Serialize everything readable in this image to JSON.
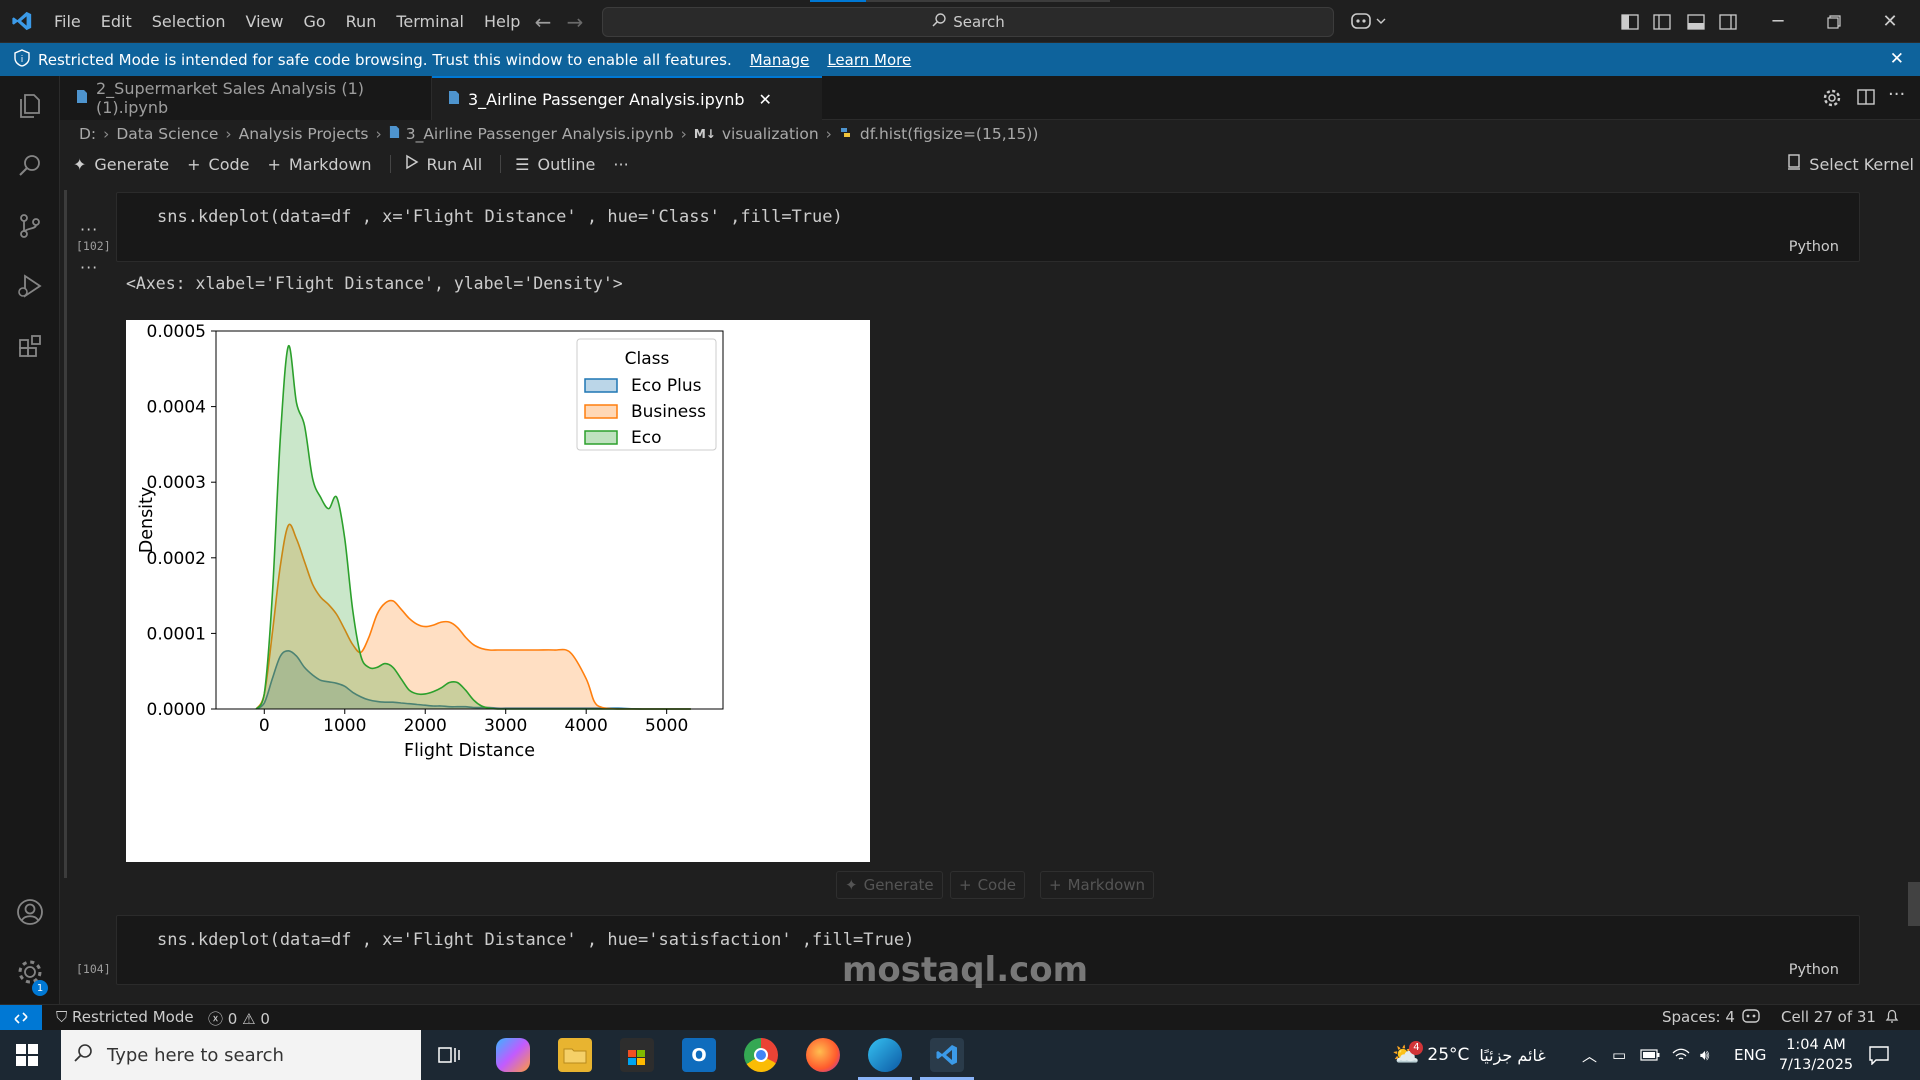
{
  "titlebar": {
    "menu": [
      "File",
      "Edit",
      "Selection",
      "View",
      "Go",
      "Run",
      "Terminal",
      "Help"
    ],
    "search_label": "Search"
  },
  "banner": {
    "message": "Restricted Mode is intended for safe code browsing. Trust this window to enable all features.",
    "manage": "Manage",
    "learn_more": "Learn More"
  },
  "tabs": [
    {
      "label": "2_Supermarket Sales Analysis (1) (1).ipynb",
      "active": false
    },
    {
      "label": "3_Airline Passenger Analysis.ipynb",
      "active": true
    }
  ],
  "breadcrumb": [
    "D:",
    "Data Science",
    "Analysis Projects",
    "3_Airline Passenger Analysis.ipynb",
    "visualization",
    "df.hist(figsize=(15,15))"
  ],
  "breadcrumb_md_tag": "M↓",
  "toolbar": {
    "generate": "Generate",
    "code": "Code",
    "markdown": "Markdown",
    "run_all": "Run All",
    "outline": "Outline",
    "more": "···",
    "select_kernel": "Select Kernel"
  },
  "cells": [
    {
      "exec": "[102]",
      "code": "sns.kdeplot(data=df , x='Flight Distance' , hue='Class' ,fill=True)",
      "lang": "Python",
      "output_text": "<Axes: xlabel='Flight Distance', ylabel='Density'>"
    },
    {
      "exec": "[104]",
      "code": "sns.kdeplot(data=df , x='Flight Distance' , hue='satisfaction' ,fill=True)",
      "lang": "Python"
    }
  ],
  "ghost_buttons": {
    "generate": "Generate",
    "code": "Code",
    "markdown": "Markdown"
  },
  "output_dots": "···",
  "chart_data": {
    "type": "area",
    "xlabel": "Flight Distance",
    "ylabel": "Density",
    "xlim": [
      -600,
      5700
    ],
    "ylim": [
      0,
      0.0005
    ],
    "xticks": [
      0,
      1000,
      2000,
      3000,
      4000,
      5000
    ],
    "yticks": [
      "0.0000",
      "0.0001",
      "0.0002",
      "0.0003",
      "0.0004",
      "0.0005"
    ],
    "legend": {
      "title": "Class",
      "placement": "top-right"
    },
    "x": [
      -100,
      0,
      100,
      200,
      300,
      400,
      500,
      600,
      700,
      800,
      900,
      1000,
      1100,
      1200,
      1300,
      1400,
      1500,
      1600,
      1700,
      1800,
      1900,
      2000,
      2100,
      2200,
      2300,
      2400,
      2500,
      2600,
      2700,
      2800,
      2900,
      3000,
      3200,
      3400,
      3600,
      3800,
      4000,
      4100,
      4200,
      4400,
      4700,
      5000,
      5300
    ],
    "series": [
      {
        "name": "Eco Plus",
        "color": "#1f77b4",
        "values": [
          0,
          8e-06,
          4e-05,
          7e-05,
          7.7e-05,
          7e-05,
          5.5e-05,
          4.5e-05,
          3.8e-05,
          3.6e-05,
          3.4e-05,
          3e-05,
          2.2e-05,
          1.6e-05,
          1.2e-05,
          1e-05,
          9e-06,
          9e-06,
          8e-06,
          7e-06,
          6e-06,
          5e-06,
          4e-06,
          4e-06,
          3e-06,
          3e-06,
          3e-06,
          2e-06,
          2e-06,
          2e-06,
          1e-06,
          1e-06,
          1e-06,
          1e-06,
          1e-06,
          1e-06,
          1e-06,
          1e-06,
          1e-06,
          1e-06,
          0,
          0,
          0
        ]
      },
      {
        "name": "Business",
        "color": "#ff7f0e",
        "values": [
          0,
          2e-05,
          0.0001,
          0.00019,
          0.000243,
          0.000225,
          0.000195,
          0.000165,
          0.000148,
          0.000138,
          0.000125,
          0.000105,
          8.5e-05,
          7.5e-05,
          9.5e-05,
          0.000125,
          0.00014,
          0.000143,
          0.000132,
          0.00012,
          0.000112,
          0.000109,
          0.000111,
          0.000115,
          0.000115,
          0.000108,
          9.5e-05,
          8.5e-05,
          8e-05,
          7.8e-05,
          7.8e-05,
          7.8e-05,
          7.8e-05,
          7.8e-05,
          7.8e-05,
          7.5e-05,
          4e-05,
          1e-05,
          2e-06,
          0,
          0,
          0,
          0
        ]
      },
      {
        "name": "Eco",
        "color": "#2ca02c",
        "values": [
          0,
          2e-05,
          0.00015,
          0.00036,
          0.00048,
          0.000405,
          0.000375,
          0.000305,
          0.00028,
          0.000265,
          0.00028,
          0.000225,
          0.00013,
          7e-05,
          5.5e-05,
          5.5e-05,
          6e-05,
          5.5e-05,
          4e-05,
          2.5e-05,
          2e-05,
          2e-05,
          2.3e-05,
          2.8e-05,
          3.5e-05,
          3.5e-05,
          2.5e-05,
          1.2e-05,
          4e-06,
          1e-06,
          0,
          0,
          0,
          0,
          0,
          0,
          0,
          0,
          0,
          0,
          0,
          0,
          0
        ]
      }
    ]
  },
  "status": {
    "restricted": "Restricted Mode",
    "errors": "0",
    "warnings": "0",
    "spaces": "Spaces: 4",
    "cell": "Cell 27 of 31"
  },
  "taskbar": {
    "search_placeholder": "Type here to search",
    "weather_temp": "25°C",
    "weather_desc": "غائم جزئيًا",
    "weather_badge": "4",
    "lang": "ENG",
    "time": "1:04 AM",
    "date": "7/13/2025"
  },
  "settings_badge": "1",
  "watermark": "mostaql.com"
}
